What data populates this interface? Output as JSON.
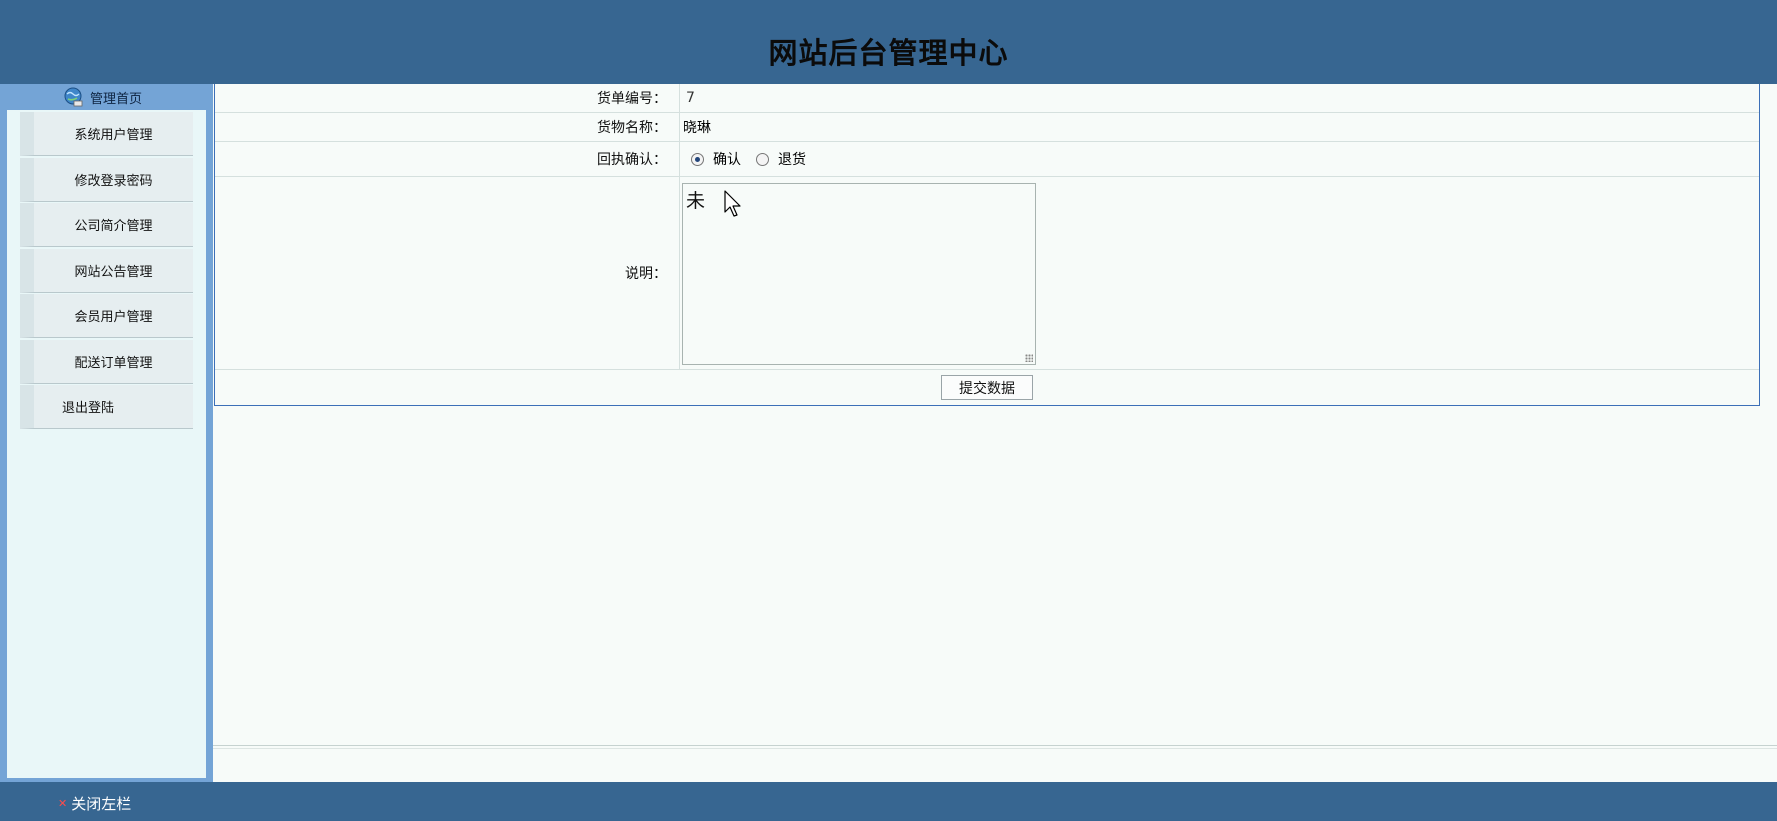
{
  "header": {
    "title": "网站后台管理中心"
  },
  "sidebar": {
    "home_label": "管理首页",
    "items": [
      {
        "label": "系统用户管理"
      },
      {
        "label": "修改登录密码"
      },
      {
        "label": "公司简介管理"
      },
      {
        "label": "网站公告管理"
      },
      {
        "label": "会员用户管理"
      },
      {
        "label": "配送订单管理"
      },
      {
        "label": "退出登陆"
      }
    ]
  },
  "form": {
    "order_no_label": "货单编号：",
    "order_no_value": "7",
    "goods_name_label": "货物名称：",
    "goods_name_value": "晓琳",
    "receipt_label": "回执确认：",
    "receipt_options": [
      {
        "label": "确认",
        "checked": true
      },
      {
        "label": "退货",
        "checked": false
      }
    ],
    "note_label": "说明：",
    "note_value": "未",
    "submit_label": "提交数据"
  },
  "footer": {
    "close_left_label": "关闭左栏"
  },
  "colors": {
    "header_bg": "#376691",
    "sidebar_bg": "#74a4d6",
    "panel_bg": "#e9f7f8",
    "content_bg": "#f7fbf9",
    "form_border": "#3c6fb8"
  }
}
